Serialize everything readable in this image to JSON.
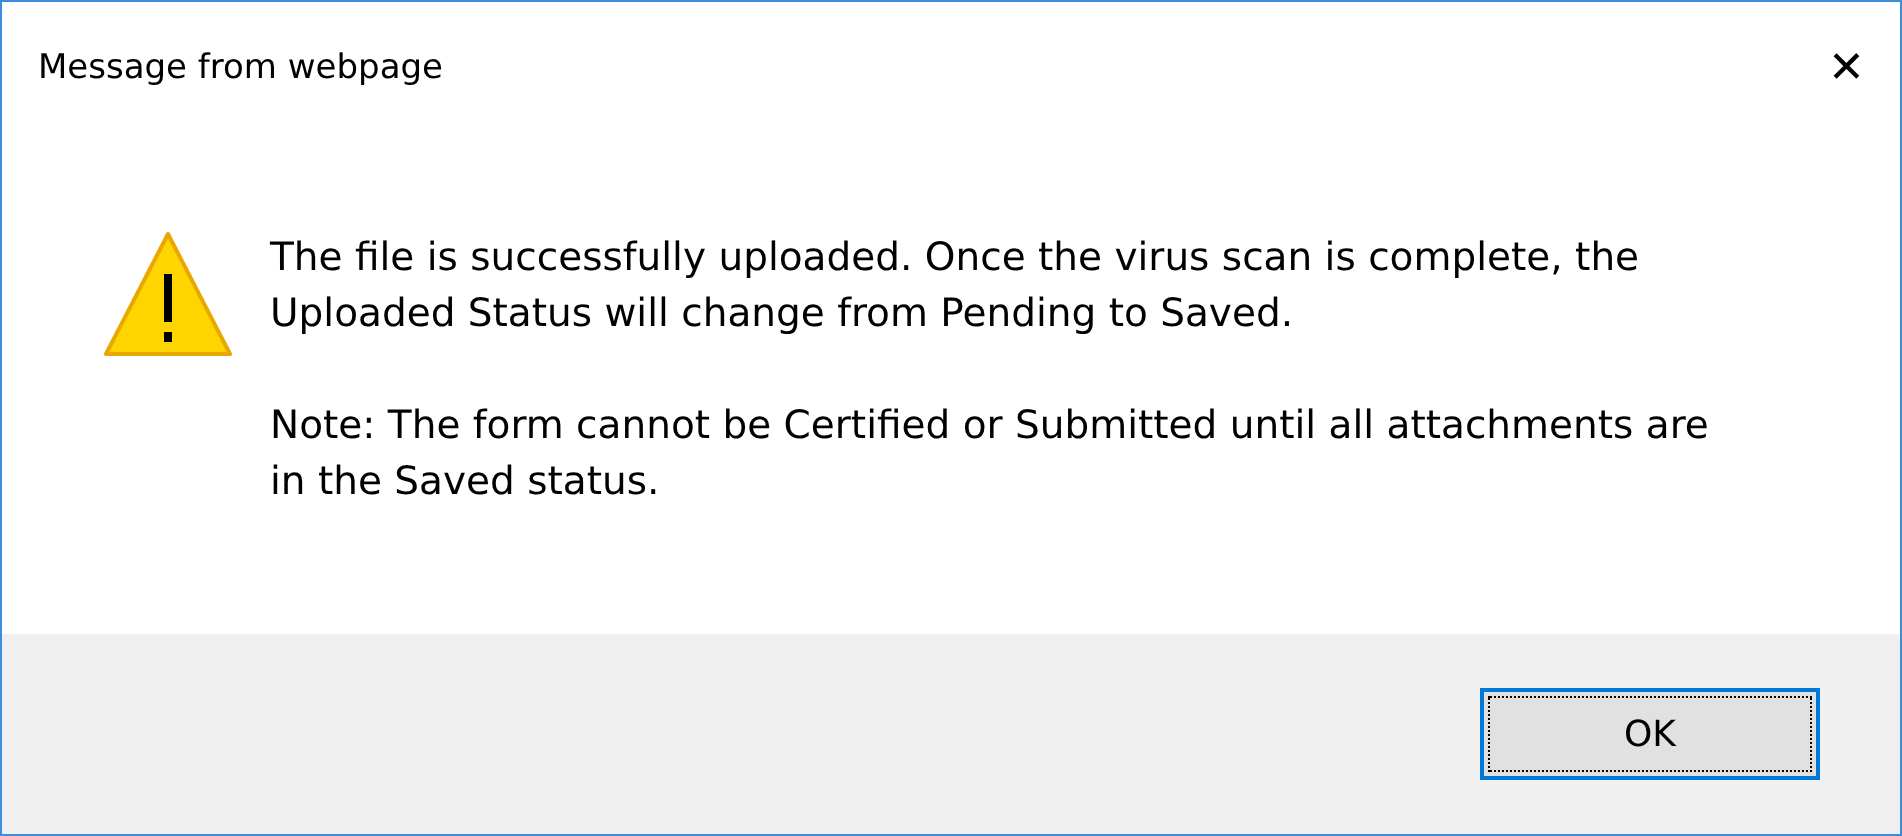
{
  "window": {
    "title": "Message from webpage",
    "close": "✕"
  },
  "message": {
    "kind": "warning",
    "paragraphs": [
      "The file is successfully uploaded. Once the virus scan is complete, the Uploaded Status will change from Pending to Saved.",
      "Note: The form cannot be Certified or Submitted until all attachments are in the Saved status."
    ]
  },
  "buttons": [
    {
      "label": "OK",
      "focused": true
    }
  ]
}
